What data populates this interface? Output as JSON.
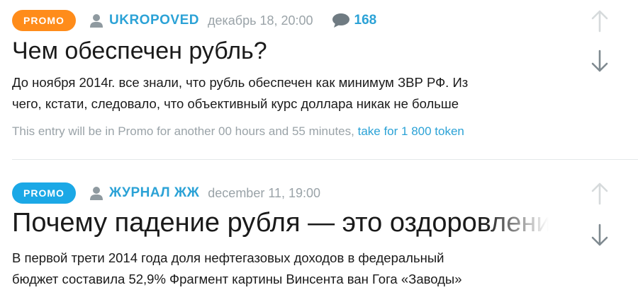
{
  "colors": {
    "promo_badge_orange": "#ff8c1a",
    "promo_badge_blue": "#1ba8e6",
    "accent_link": "#2ba2d6",
    "muted_text": "#9aa3a8",
    "vote_up_inactive": "#d6dadc",
    "vote_down": "#7f8a90"
  },
  "entries": [
    {
      "badge": "PROMO",
      "author": "UKROPOVED",
      "date": "декабрь 18, 20:00",
      "comments_count": "168",
      "title": "Чем обеспечен рубль?",
      "excerpt_lines": [
        "До ноября 2014г. все знали, что рубль обеспечен как минимум ЗВР РФ. Из",
        "чего, кстати, следовало, что объективный курс доллара никак не больше"
      ],
      "promo_note": "This entry will be in Promo for another 00 hours and 55 minutes, ",
      "promo_link": "take for 1 800 token",
      "icons": [
        "user-icon",
        "comment-icon",
        "arrow-up-icon",
        "arrow-down-icon"
      ]
    },
    {
      "badge": "PROMO",
      "author": "ЖУРНАЛ ЖЖ",
      "date": "december 11, 19:00",
      "title": "Почему падение рубля — это оздоровлени",
      "excerpt_lines": [
        "В первой трети 2014 года доля нефтегазовых доходов в федеральный",
        "бюджет составила 52,9% Фрагмент картины Винсента ван Гога «Заводы»"
      ],
      "icons": [
        "user-icon",
        "arrow-up-icon",
        "arrow-down-icon"
      ]
    }
  ]
}
